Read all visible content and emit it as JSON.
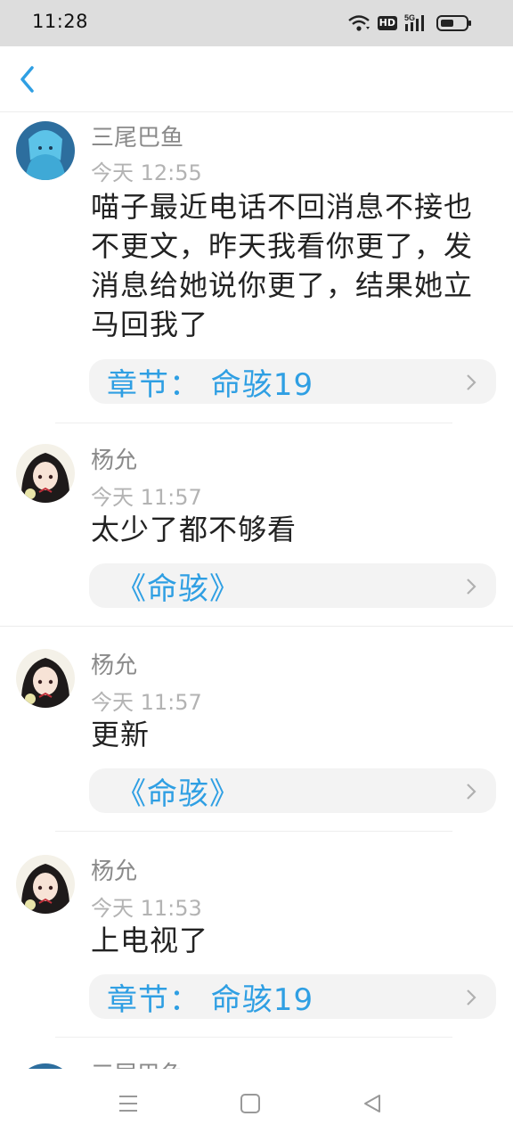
{
  "status_bar": {
    "time": "11:28",
    "wifi_icon": "wifi-icon",
    "hd_label": "HD",
    "network_label": "5G",
    "battery_icon": "battery-icon"
  },
  "header": {
    "back_icon": "chevron-left-icon"
  },
  "messages": [
    {
      "name": "三尾巴鱼",
      "time": "今天 12:55",
      "content": "喵子最近电话不回消息不接也不更文，昨天我看你更了，发消息给她说你更了，结果她立马回我了",
      "card": "章节：  命骇19"
    },
    {
      "name": "杨允",
      "time": "今天 11:57",
      "content": "太少了都不够看",
      "card": "《命骇》"
    },
    {
      "name": "杨允",
      "time": "今天 11:57",
      "content": "更新",
      "card": "《命骇》"
    },
    {
      "name": "杨允",
      "time": "今天 11:53",
      "content": "上电视了",
      "card": "章节：  命骇19"
    },
    {
      "name": "三尾巴鱼"
    }
  ],
  "nav_bar": {
    "menu_icon": "menu-icon",
    "home_icon": "home-square-icon",
    "back_icon": "back-triangle-icon"
  },
  "colors": {
    "accent": "#2f9fe3",
    "card_bg": "#f3f3f3",
    "status_bar_bg": "#dddddd"
  }
}
